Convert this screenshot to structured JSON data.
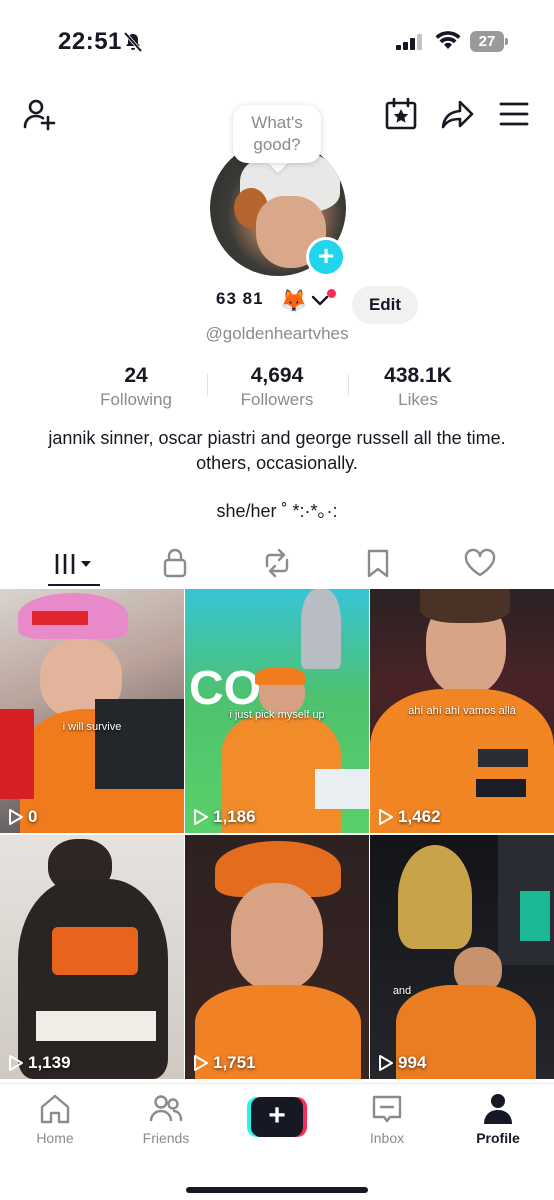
{
  "status_bar": {
    "time": "22:51",
    "battery": "27"
  },
  "header": {
    "add_friend_icon": "person-plus-icon",
    "calendar_icon": "calendar-star-icon",
    "share_icon": "share-arrow-icon",
    "menu_icon": "hamburger-menu-icon"
  },
  "profile": {
    "bubble_text": "What's good?",
    "display_name": "63 81",
    "name_emoji": "🦊",
    "edit_label": "Edit",
    "username": "@goldenheartvhes",
    "stats": [
      {
        "value": "24",
        "label": "Following"
      },
      {
        "value": "4,694",
        "label": "Followers"
      },
      {
        "value": "438.1K",
        "label": "Likes"
      }
    ],
    "bio": "jannik sinner, oscar piastri and george russell all the time. others, occasionally.",
    "pronouns": "she/her ˚ *:·*｡·:"
  },
  "tabs": [
    "videos-tab",
    "private-tab",
    "reposts-tab",
    "saved-tab",
    "liked-tab"
  ],
  "videos": [
    {
      "views": "0",
      "caption": "i will survive"
    },
    {
      "views": "1,186",
      "caption": "i just pick myself up"
    },
    {
      "views": "1,462",
      "caption": "ahí ahí ahí vamos allá"
    },
    {
      "views": "1,139",
      "caption": ""
    },
    {
      "views": "1,751",
      "caption": ""
    },
    {
      "views": "994",
      "caption": "and"
    }
  ],
  "bottom_nav": [
    {
      "label": "Home"
    },
    {
      "label": "Friends"
    },
    {
      "label": ""
    },
    {
      "label": "Inbox"
    },
    {
      "label": "Profile"
    }
  ],
  "colors": {
    "accent_cyan": "#20d5ec",
    "accent_pink": "#fe2c55",
    "text_primary": "#161823",
    "text_secondary": "#8a8b91"
  }
}
